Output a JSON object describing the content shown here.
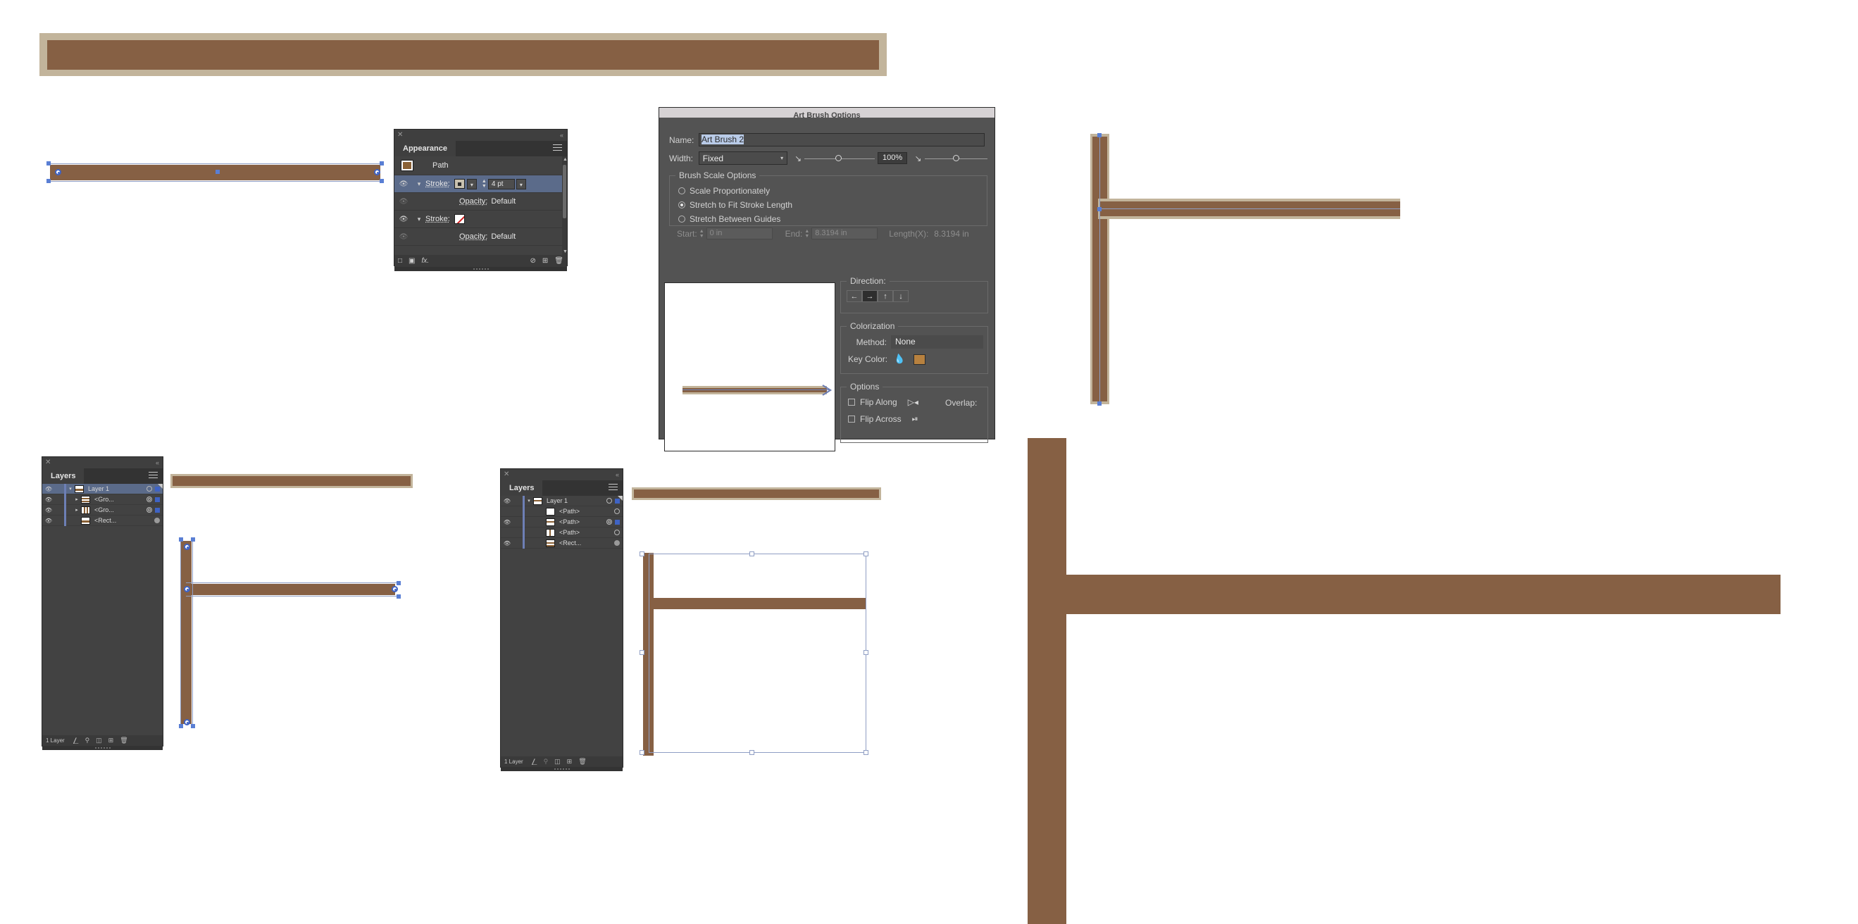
{
  "app": "Adobe Illustrator",
  "artwork": {
    "brown": "#866044",
    "border_tan": "#c2b49b",
    "selection_blue": "#8f9ec4",
    "anchor_blue": "#3f63c4"
  },
  "appearance_panel": {
    "tab_label": "Appearance",
    "close_icon": "close-icon",
    "collapse_icon": "double-chevron-left-icon",
    "menu_icon": "hamburger-menu-icon",
    "rows": [
      {
        "type": "object",
        "label": "Path",
        "swatch": "brown-fill-swatch"
      },
      {
        "type": "stroke",
        "label": "Stroke:",
        "swatch": "brush-swatch",
        "weight": "4 pt",
        "selected": true
      },
      {
        "type": "opacity",
        "label": "Opacity:",
        "value": "Default"
      },
      {
        "type": "stroke",
        "label": "Stroke:",
        "swatch": "none-swatch"
      },
      {
        "type": "opacity",
        "label": "Opacity:",
        "value": "Default"
      }
    ],
    "footer_icons": [
      "add-new-stroke-icon",
      "add-new-fill-icon",
      "add-new-effect-icon",
      "clear-appearance-icon",
      "duplicate-item-icon",
      "delete-item-icon"
    ]
  },
  "layers_panel_1": {
    "tab_label": "Layers",
    "close_icon": "close-icon",
    "collapse_icon": "double-chevron-left-icon",
    "menu_icon": "hamburger-menu-icon",
    "rows": [
      {
        "name": "Layer 1",
        "visible": true,
        "expanded": true,
        "selected": true,
        "indent": 0,
        "thumb": "hbar",
        "target": "circle",
        "sel_square": true
      },
      {
        "name": "<Gro...",
        "visible": true,
        "expanded": false,
        "selected": false,
        "indent": 1,
        "thumb": "hbar",
        "target": "double-circle",
        "sel_square": true
      },
      {
        "name": "<Gro...",
        "visible": true,
        "expanded": false,
        "selected": false,
        "indent": 1,
        "thumb": "vbar",
        "target": "double-circle",
        "sel_square": true
      },
      {
        "name": "<Rect...",
        "visible": true,
        "expanded": null,
        "selected": false,
        "indent": 1,
        "thumb": "hbar",
        "target": "filled",
        "sel_square": false
      }
    ],
    "footer_count": "1 Layer",
    "footer_icons": [
      "locate-object-icon",
      "make-clipping-mask-icon",
      "create-new-sublayer-icon",
      "create-new-layer-icon",
      "delete-selection-icon"
    ]
  },
  "layers_panel_2": {
    "tab_label": "Layers",
    "close_icon": "close-icon",
    "collapse_icon": "double-chevron-left-icon",
    "menu_icon": "hamburger-menu-icon",
    "rows": [
      {
        "name": "Layer 1",
        "visible": true,
        "expanded": true,
        "selected": false,
        "indent": 0,
        "thumb": "hbar",
        "target": "circle",
        "sel_square": true
      },
      {
        "name": "<Path>",
        "visible": false,
        "expanded": null,
        "selected": false,
        "indent": 2,
        "thumb": "blank",
        "target": "circle",
        "sel_square": false
      },
      {
        "name": "<Path>",
        "visible": true,
        "expanded": null,
        "selected": false,
        "indent": 2,
        "thumb": "hbar",
        "target": "double-circle",
        "sel_square": true
      },
      {
        "name": "<Path>",
        "visible": false,
        "expanded": null,
        "selected": false,
        "indent": 2,
        "thumb": "vbar",
        "target": "circle",
        "sel_square": false
      },
      {
        "name": "<Rect...",
        "visible": true,
        "expanded": null,
        "selected": false,
        "indent": 2,
        "thumb": "hbar",
        "target": "filled",
        "sel_square": false
      }
    ],
    "footer_count": "1 Layer",
    "footer_icons": [
      "locate-object-icon",
      "make-clipping-mask-icon",
      "create-new-sublayer-icon",
      "create-new-layer-icon",
      "delete-selection-icon"
    ]
  },
  "dialog": {
    "title": "Art Brush Options",
    "name_label": "Name:",
    "name_value": "Art Brush 2",
    "width_label": "Width:",
    "width_value": "Fixed",
    "width_percent": "100%",
    "scale_group_title": "Brush Scale Options",
    "scale_options": [
      {
        "label": "Scale Proportionately",
        "selected": false
      },
      {
        "label": "Stretch to Fit Stroke Length",
        "selected": true
      },
      {
        "label": "Stretch Between Guides",
        "selected": false
      }
    ],
    "start_label": "Start:",
    "start_value": "0 in",
    "end_label": "End:",
    "end_value": "8.3194 in",
    "length_label": "Length(X):",
    "length_value": "8.3194 in",
    "direction_title": "Direction:",
    "direction_buttons": [
      {
        "icon": "arrow-left-icon",
        "glyph": "←",
        "selected": false
      },
      {
        "icon": "arrow-right-icon",
        "glyph": "→",
        "selected": true
      },
      {
        "icon": "arrow-up-icon",
        "glyph": "↑",
        "selected": false
      },
      {
        "icon": "arrow-down-icon",
        "glyph": "↓",
        "selected": false
      }
    ],
    "colorization_title": "Colorization",
    "method_label": "Method:",
    "method_value": "None",
    "key_color_label": "Key Color:",
    "key_color_icon": "eyedropper-icon",
    "key_color_hex": "#b7813f",
    "options_title": "Options",
    "flip_along_label": "Flip Along",
    "flip_along_icon": "flip-along-icon",
    "flip_across_label": "Flip Across",
    "flip_across_icon": "flip-across-icon",
    "overlap_label": "Overlap:"
  }
}
